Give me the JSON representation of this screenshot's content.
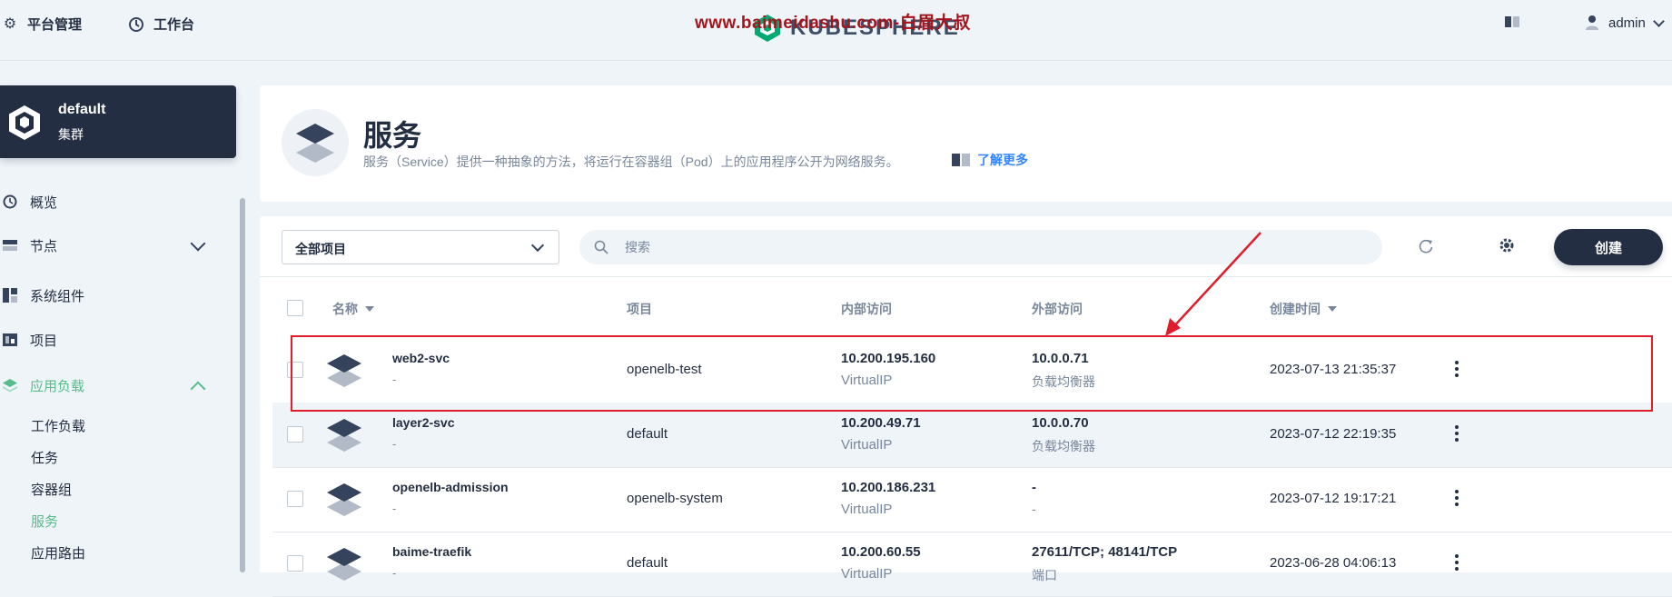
{
  "topbar": {
    "platform_label": "平台管理",
    "workbench_label": "工作台",
    "logo_text": "KUBESPHERE",
    "watermark": "www.baimeidashu.com-白眉大叔",
    "user_name": "admin"
  },
  "cluster": {
    "name": "default",
    "type": "集群"
  },
  "sidebar": {
    "items": [
      {
        "label": "概览",
        "icon": "dashboard-icon"
      },
      {
        "label": "节点",
        "icon": "server-icon"
      },
      {
        "label": "系统组件",
        "icon": "components-icon"
      },
      {
        "label": "项目",
        "icon": "project-icon"
      },
      {
        "label": "应用负载",
        "icon": "layers-icon"
      }
    ],
    "sub_items": [
      "工作负载",
      "任务",
      "容器组",
      "服务",
      "应用路由"
    ],
    "active_sub": "服务"
  },
  "header": {
    "title": "服务",
    "description": "服务（Service）提供一种抽象的方法，将运行在容器组（Pod）上的应用程序公开为网络服务。",
    "learn_more": "了解更多"
  },
  "toolbar": {
    "project_select": "全部项目",
    "search_placeholder": "搜索",
    "create_label": "创建"
  },
  "table": {
    "columns": [
      "名称",
      "项目",
      "内部访问",
      "外部访问",
      "创建时间"
    ],
    "rows": [
      {
        "name": "web2-svc",
        "sub": "-",
        "project": "openelb-test",
        "internal_ip": "10.200.195.160",
        "internal_type": "VirtualIP",
        "external": "10.0.0.71",
        "external_type": "负载均衡器",
        "created": "2023-07-13 21:35:37"
      },
      {
        "name": "layer2-svc",
        "sub": "-",
        "project": "default",
        "internal_ip": "10.200.49.71",
        "internal_type": "VirtualIP",
        "external": "10.0.0.70",
        "external_type": "负载均衡器",
        "created": "2023-07-12 22:19:35"
      },
      {
        "name": "openelb-admission",
        "sub": "-",
        "project": "openelb-system",
        "internal_ip": "10.200.186.231",
        "internal_type": "VirtualIP",
        "external": "-",
        "external_type": "-",
        "created": "2023-07-12 19:17:21"
      },
      {
        "name": "baime-traefik",
        "sub": "-",
        "project": "default",
        "internal_ip": "10.200.60.55",
        "internal_type": "VirtualIP",
        "external": "27611/TCP; 48141/TCP",
        "external_type": "端口",
        "created": "2023-06-28 04:06:13"
      }
    ]
  },
  "colors": {
    "dark": "#242e42",
    "accent_green": "#55bc8a",
    "link_blue": "#3385ff",
    "annotation_red": "#e01e2b"
  }
}
